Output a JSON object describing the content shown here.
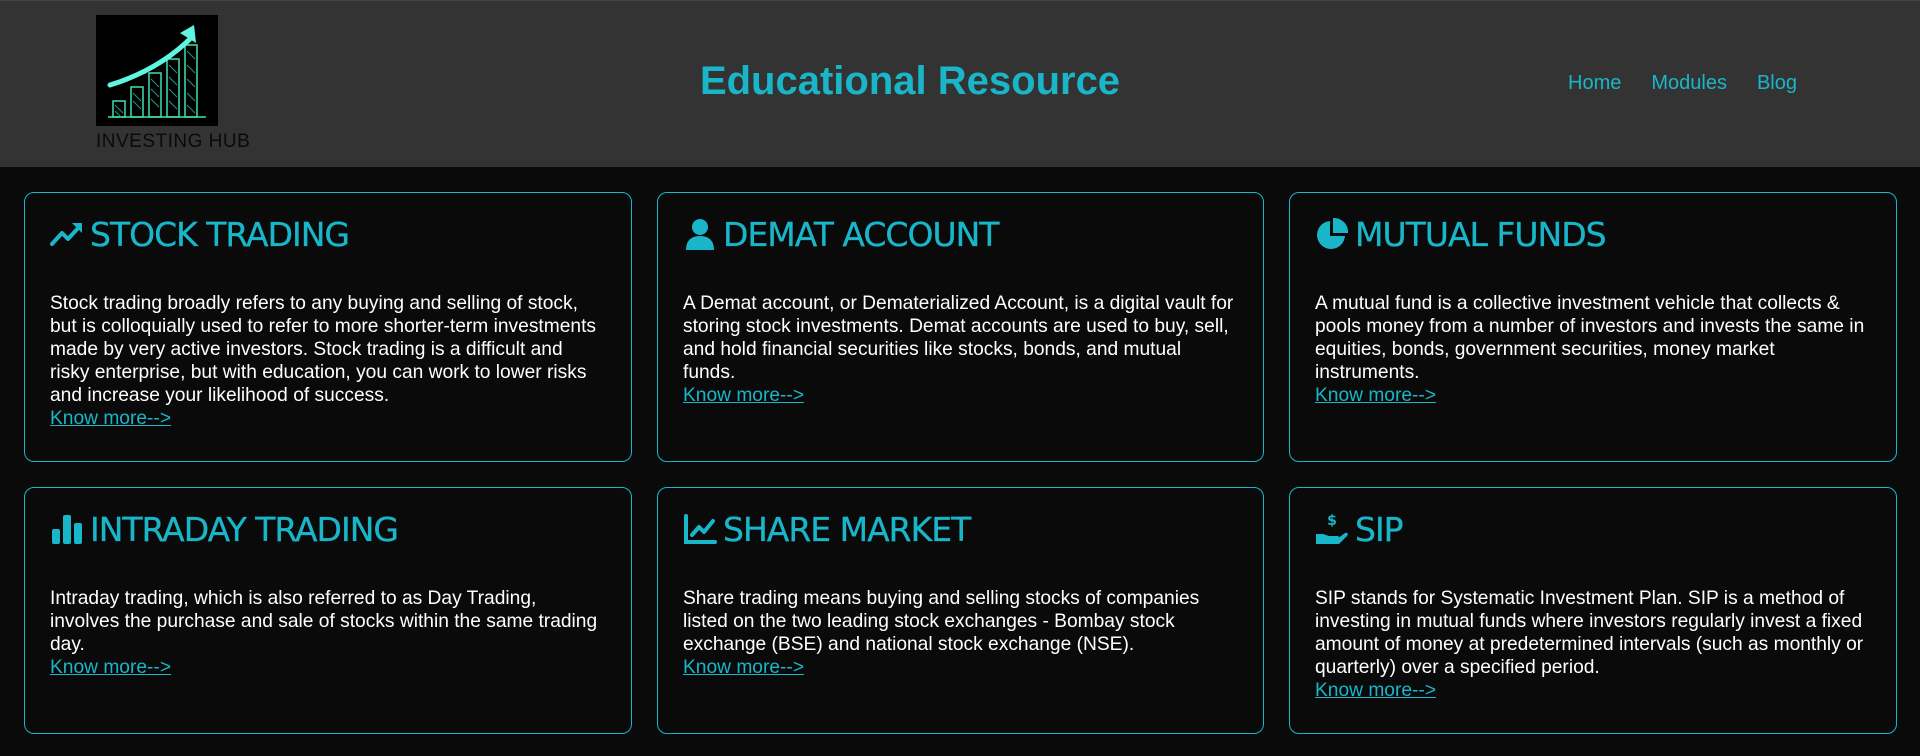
{
  "header": {
    "brand": "INVESTING HUB",
    "title": "Educational Resource",
    "nav": [
      "Home",
      "Modules",
      "Blog"
    ]
  },
  "cards": [
    {
      "title": "STOCK TRADING",
      "icon": "trend-up-icon",
      "description": "Stock trading broadly refers to any buying and selling of stock, but is colloquially used to refer to more shorter-term investments made by very active investors. Stock trading is a difficult and risky enterprise, but with education, you can work to lower risks and increase your likelihood of success.",
      "link": "Know more-->"
    },
    {
      "title": "DEMAT ACCOUNT",
      "icon": "user-icon",
      "description": "A Demat account, or Dematerialized Account, is a digital vault for storing stock investments. Demat accounts are used to buy, sell, and hold financial securities like stocks, bonds, and mutual funds.",
      "link": "Know more-->"
    },
    {
      "title": "MUTUAL FUNDS",
      "icon": "pie-chart-icon",
      "description": "A mutual fund is a collective investment vehicle that collects & pools money from a number of investors and invests the same in equities, bonds, government securities, money market instruments.",
      "link": "Know more-->"
    },
    {
      "title": "INTRADAY TRADING",
      "icon": "bar-chart-icon",
      "description": "Intraday trading, which is also referred to as Day Trading, involves the purchase and sale of stocks within the same trading day.",
      "link": "Know more-->"
    },
    {
      "title": "SHARE MARKET",
      "icon": "line-chart-icon",
      "description": "Share trading means buying and selling stocks of companies listed on the two leading stock exchanges - Bombay stock exchange (BSE) and national stock exchange (NSE).",
      "link": "Know more-->"
    },
    {
      "title": "SIP",
      "icon": "hand-dollar-icon",
      "description": "SIP stands for Systematic Investment Plan. SIP is a method of investing in mutual funds where investors regularly invest a fixed amount of money at predetermined intervals (such as monthly or quarterly) over a specified period.",
      "link": "Know more-->"
    }
  ],
  "colors": {
    "accent": "#19b6c9",
    "header_bg": "#333333",
    "page_bg": "#0a0a0a"
  }
}
